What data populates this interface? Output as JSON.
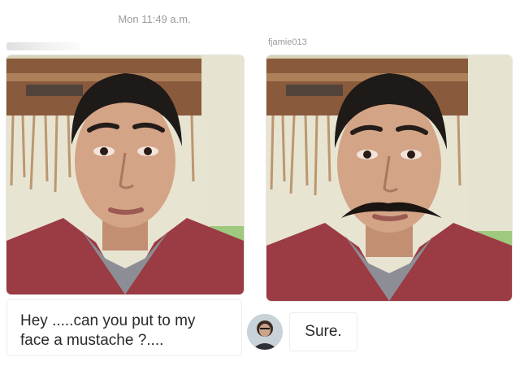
{
  "header": {
    "timestamp": "Mon 11:49 a.m."
  },
  "conversation": {
    "sender_username": "fjamie013",
    "outgoing_message": "Hey .....can you put to my face a mustache ?....",
    "reply_message": "Sure."
  },
  "colors": {
    "meta_text": "#9a9a9a",
    "bubble_border": "#ececec",
    "shirt": "#9b3b43",
    "wall": "#e7e3cf"
  },
  "icons": {
    "avatar": "profile-avatar-icon"
  }
}
